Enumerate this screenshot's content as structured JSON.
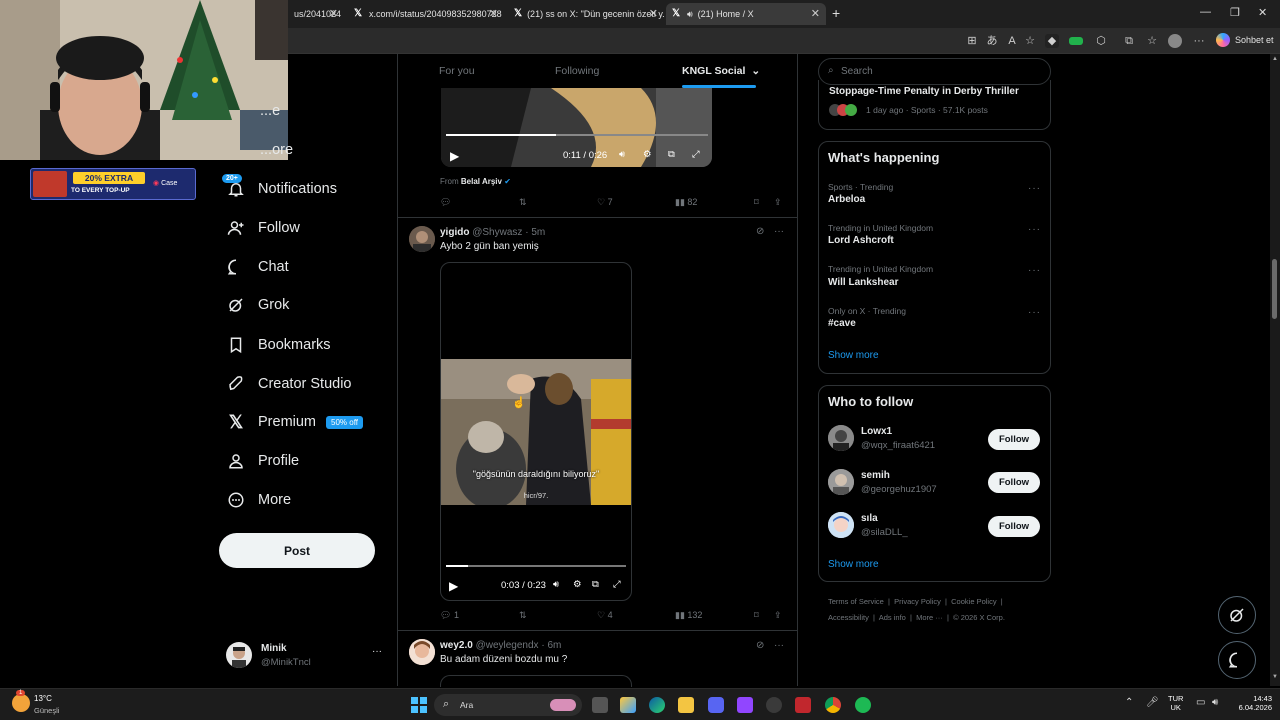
{
  "browser": {
    "tabs": [
      {
        "title": "us/2041024",
        "active": false
      },
      {
        "title": "x.com/i/status/204098352980728",
        "active": false
      },
      {
        "title": "(21) ss on X: \"Dün gecenin özeti y...",
        "active": false
      },
      {
        "title": "(21) Home / X",
        "active": true
      }
    ],
    "new_tab": "+",
    "sohbet_label": "Sohbet et"
  },
  "ad": {
    "headline": "20% EXTRA",
    "sub": "TO EVERY TOP-UP",
    "brand": "Case"
  },
  "sidebar": {
    "items": [
      {
        "label": "...e",
        "icon": "home-icon"
      },
      {
        "label": "...ore",
        "icon": "explore-icon"
      },
      {
        "label": "Notifications",
        "icon": "bell-icon",
        "badge": "20+"
      },
      {
        "label": "Follow",
        "icon": "follow-icon"
      },
      {
        "label": "Chat",
        "icon": "chat-icon"
      },
      {
        "label": "Grok",
        "icon": "grok-icon"
      },
      {
        "label": "Bookmarks",
        "icon": "bookmark-icon"
      },
      {
        "label": "Creator Studio",
        "icon": "rocket-icon"
      },
      {
        "label": "Premium",
        "icon": "x-logo-icon",
        "badge": "50% off"
      },
      {
        "label": "Profile",
        "icon": "person-icon"
      },
      {
        "label": "More",
        "icon": "more-circle-icon"
      }
    ],
    "post_label": "Post",
    "account": {
      "name": "Minik",
      "handle": "@MinikTncl"
    }
  },
  "timeline": {
    "tabs": [
      "For you",
      "Following",
      "KNGL Social"
    ],
    "posts": [
      {
        "video_time": "0:11 / 0:26",
        "from_prefix": "From",
        "from_name": "Belal Arşiv",
        "stats": {
          "replies": "",
          "reposts": "",
          "likes": "7",
          "views": "82"
        }
      },
      {
        "name": "yigido",
        "handle": "@Shywasz",
        "time": "5m",
        "text": "Aybo 2 gün ban yemiş",
        "subtitle": "\"göğsünün daraldığını biliyoruz\"",
        "watermark": "hicr/97.",
        "video_time": "0:03 / 0:23",
        "stats": {
          "replies": "1",
          "reposts": "",
          "likes": "4",
          "views": "132"
        }
      },
      {
        "name": "wey2.0",
        "handle": "@weylegendx",
        "time": "6m",
        "text": "Bu adam düzeni bozdu mu ?"
      }
    ]
  },
  "right": {
    "search_placeholder": "Search",
    "top_card": {
      "title": "Stoppage-Time Penalty in Derby Thriller",
      "meta": "1 day ago · Sports · 57.1K posts"
    },
    "happening_title": "What's happening",
    "trends": [
      {
        "category": "Sports · Trending",
        "name": "Arbeloa"
      },
      {
        "category": "Trending in United Kingdom",
        "name": "Lord Ashcroft"
      },
      {
        "category": "Trending in United Kingdom",
        "name": "Will Lankshear"
      },
      {
        "category": "Only on X · Trending",
        "name": "#cave"
      }
    ],
    "show_more": "Show more",
    "who_to_follow_title": "Who to follow",
    "who_to_follow": [
      {
        "name": "Lowx1",
        "handle": "@wqx_firaat6421",
        "button": "Follow"
      },
      {
        "name": "semih",
        "handle": "@georgehuz1907",
        "button": "Follow"
      },
      {
        "name": "sıla",
        "handle": "@silaDLL_",
        "button": "Follow"
      }
    ],
    "show_more_2": "Show more",
    "footer": {
      "line1": [
        "Terms of Service",
        "Privacy Policy",
        "Cookie Policy"
      ],
      "line2": [
        "Accessibility",
        "Ads info",
        "More ···",
        "© 2026 X Corp."
      ]
    }
  },
  "taskbar": {
    "weather_temp": "13°C",
    "weather_desc": "Güneşli",
    "search_label": "Ara",
    "lang1": "TUR",
    "lang2": "UK",
    "time": "14:43",
    "date": "6.04.2026",
    "badge": "1"
  },
  "colors": {
    "accent": "#1d9bf0",
    "bg": "#000000",
    "border": "#2f3336",
    "muted": "#71767b"
  }
}
